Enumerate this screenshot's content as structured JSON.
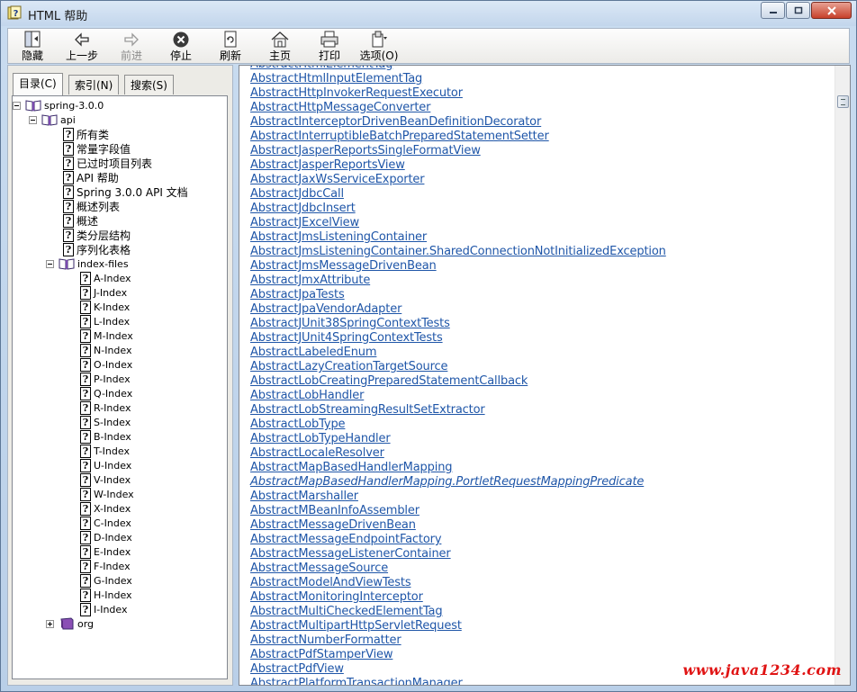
{
  "window": {
    "title": "HTML 帮助"
  },
  "toolbar": {
    "buttons": [
      {
        "label": "隐藏",
        "icon": "hide-icon",
        "enabled": true
      },
      {
        "label": "上一步",
        "icon": "back-arrow-icon",
        "enabled": true
      },
      {
        "label": "前进",
        "icon": "forward-arrow-icon",
        "enabled": false
      },
      {
        "label": "停止",
        "icon": "stop-icon",
        "enabled": true
      },
      {
        "label": "刷新",
        "icon": "refresh-icon",
        "enabled": true
      },
      {
        "label": "主页",
        "icon": "home-icon",
        "enabled": true
      },
      {
        "label": "打印",
        "icon": "print-icon",
        "enabled": true
      },
      {
        "label": "选项(O)",
        "icon": "options-icon",
        "enabled": true
      }
    ]
  },
  "nav_tabs": [
    {
      "label": "目录(C)",
      "active": true
    },
    {
      "label": "索引(N)",
      "active": false
    },
    {
      "label": "搜索(S)",
      "active": false
    }
  ],
  "tree": {
    "root": {
      "label": "spring-3.0.0",
      "expanded": true
    },
    "api": {
      "label": "api",
      "expanded": true
    },
    "api_pages": [
      "所有类",
      "常量字段值",
      "已过时项目列表",
      "API 帮助",
      "Spring 3.0.0 API 文档",
      "概述列表",
      "概述",
      "类分层结构",
      "序列化表格"
    ],
    "index_files": {
      "label": "index-files",
      "expanded": true
    },
    "index_pages": [
      "A-Index",
      "J-Index",
      "K-Index",
      "L-Index",
      "M-Index",
      "N-Index",
      "O-Index",
      "P-Index",
      "Q-Index",
      "R-Index",
      "S-Index",
      "B-Index",
      "T-Index",
      "U-Index",
      "V-Index",
      "W-Index",
      "X-Index",
      "C-Index",
      "D-Index",
      "E-Index",
      "F-Index",
      "G-Index",
      "H-Index",
      "I-Index"
    ],
    "org": {
      "label": "org",
      "expanded": false
    }
  },
  "content": {
    "links": [
      {
        "text": "AbstractHtmlElementTag",
        "italic": false
      },
      {
        "text": "AbstractHtmlInputElementTag",
        "italic": false
      },
      {
        "text": "AbstractHttpInvokerRequestExecutor",
        "italic": false
      },
      {
        "text": "AbstractHttpMessageConverter",
        "italic": false
      },
      {
        "text": "AbstractInterceptorDrivenBeanDefinitionDecorator",
        "italic": false
      },
      {
        "text": "AbstractInterruptibleBatchPreparedStatementSetter",
        "italic": false
      },
      {
        "text": "AbstractJasperReportsSingleFormatView",
        "italic": false
      },
      {
        "text": "AbstractJasperReportsView",
        "italic": false
      },
      {
        "text": "AbstractJaxWsServiceExporter",
        "italic": false
      },
      {
        "text": "AbstractJdbcCall",
        "italic": false
      },
      {
        "text": "AbstractJdbcInsert",
        "italic": false
      },
      {
        "text": "AbstractJExcelView",
        "italic": false
      },
      {
        "text": "AbstractJmsListeningContainer",
        "italic": false
      },
      {
        "text": "AbstractJmsListeningContainer.SharedConnectionNotInitializedException",
        "italic": false
      },
      {
        "text": "AbstractJmsMessageDrivenBean",
        "italic": false
      },
      {
        "text": "AbstractJmxAttribute",
        "italic": false
      },
      {
        "text": "AbstractJpaTests",
        "italic": false
      },
      {
        "text": "AbstractJpaVendorAdapter",
        "italic": false
      },
      {
        "text": "AbstractJUnit38SpringContextTests",
        "italic": false
      },
      {
        "text": "AbstractJUnit4SpringContextTests",
        "italic": false
      },
      {
        "text": "AbstractLabeledEnum",
        "italic": false
      },
      {
        "text": "AbstractLazyCreationTargetSource",
        "italic": false
      },
      {
        "text": "AbstractLobCreatingPreparedStatementCallback",
        "italic": false
      },
      {
        "text": "AbstractLobHandler",
        "italic": false
      },
      {
        "text": "AbstractLobStreamingResultSetExtractor",
        "italic": false
      },
      {
        "text": "AbstractLobType",
        "italic": false
      },
      {
        "text": "AbstractLobTypeHandler",
        "italic": false
      },
      {
        "text": "AbstractLocaleResolver",
        "italic": false
      },
      {
        "text": "AbstractMapBasedHandlerMapping",
        "italic": false
      },
      {
        "text": "AbstractMapBasedHandlerMapping.PortletRequestMappingPredicate",
        "italic": true
      },
      {
        "text": "AbstractMarshaller",
        "italic": false
      },
      {
        "text": "AbstractMBeanInfoAssembler",
        "italic": false
      },
      {
        "text": "AbstractMessageDrivenBean",
        "italic": false
      },
      {
        "text": "AbstractMessageEndpointFactory",
        "italic": false
      },
      {
        "text": "AbstractMessageListenerContainer",
        "italic": false
      },
      {
        "text": "AbstractMessageSource",
        "italic": false
      },
      {
        "text": "AbstractModelAndViewTests",
        "italic": false
      },
      {
        "text": "AbstractMonitoringInterceptor",
        "italic": false
      },
      {
        "text": "AbstractMultiCheckedElementTag",
        "italic": false
      },
      {
        "text": "AbstractMultipartHttpServletRequest",
        "italic": false
      },
      {
        "text": "AbstractNumberFormatter",
        "italic": false
      },
      {
        "text": "AbstractPdfStamperView",
        "italic": false
      },
      {
        "text": "AbstractPdfView",
        "italic": false
      },
      {
        "text": "AbstractPlatformTransactionManager",
        "italic": false
      }
    ]
  },
  "watermark": "www.java1234.com",
  "colors": {
    "link": "#1f56a8",
    "watermark": "#e01414"
  }
}
